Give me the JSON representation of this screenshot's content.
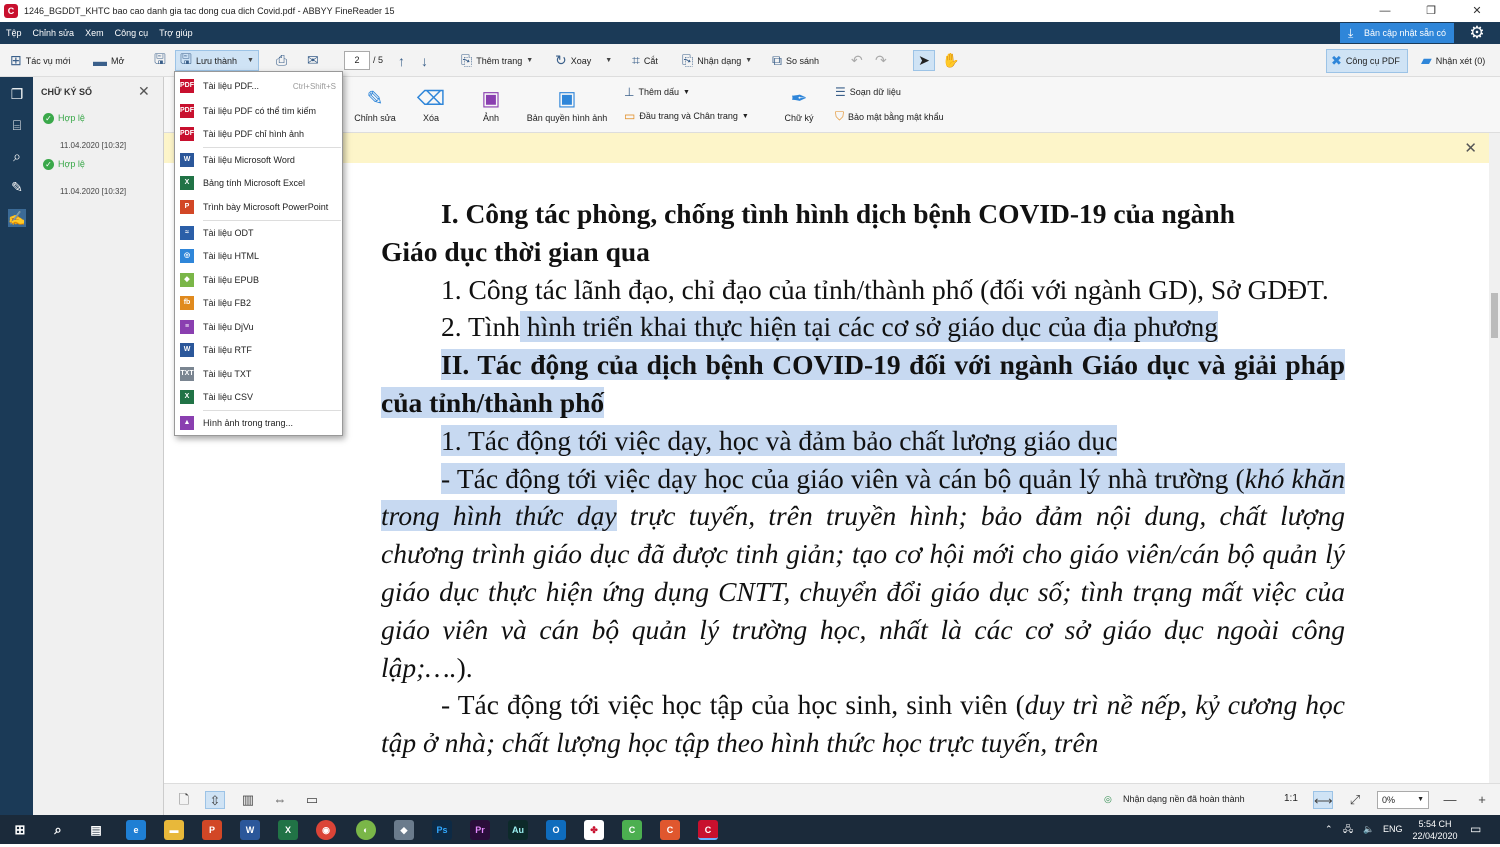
{
  "window": {
    "title": "1246_BGDDT_KHTC  bao cao danh gia tac dong cua dich Covid.pdf - ABBYY FineReader 15",
    "logo": "C"
  },
  "menubar": {
    "items": [
      "Tệp",
      "Chỉnh sửa",
      "Xem",
      "Công cụ",
      "Trợ giúp"
    ],
    "update_label": "Bản cập nhật sẵn có"
  },
  "toolbar": {
    "new_task": "Tác vụ mới",
    "open": "Mở",
    "save_as": "Lưu thành",
    "page_current": "2",
    "page_total": "/ 5",
    "add_page": "Thêm trang",
    "rotate": "Xoay",
    "crop": "Cắt",
    "recognize": "Nhận dạng",
    "compare": "So sánh",
    "pdf_tools": "Công cụ PDF",
    "comments": "Nhận xét (0)"
  },
  "save_menu": {
    "items": [
      {
        "label": "Tài liệu PDF...",
        "shortcut": "Ctrl+Shift+S",
        "icon": "PDF",
        "color": "#c8102e"
      },
      {
        "label": "Tài liệu PDF có thể tìm kiếm",
        "icon": "PDF",
        "color": "#c8102e"
      },
      {
        "label": "Tài liệu PDF chỉ hình ảnh",
        "icon": "PDF",
        "color": "#c8102e"
      },
      {
        "label": "Tài liệu Microsoft Word",
        "icon": "W",
        "color": "#2b579a"
      },
      {
        "label": "Bảng tính Microsoft Excel",
        "icon": "X",
        "color": "#217346"
      },
      {
        "label": "Trình bày Microsoft PowerPoint",
        "icon": "P",
        "color": "#d24726"
      },
      {
        "label": "Tài liệu ODT",
        "icon": "≈",
        "color": "#2b5fa8"
      },
      {
        "label": "Tài liệu HTML",
        "icon": "◎",
        "color": "#2f86d9"
      },
      {
        "label": "Tài liệu EPUB",
        "icon": "◆",
        "color": "#7ab648"
      },
      {
        "label": "Tài liệu FB2",
        "icon": "fb",
        "color": "#e08a1e"
      },
      {
        "label": "Tài liệu DjVu",
        "icon": "≡",
        "color": "#8a3fb0"
      },
      {
        "label": "Tài liệu RTF",
        "icon": "W",
        "color": "#2b579a"
      },
      {
        "label": "Tài liệu TXT",
        "icon": "TXT",
        "color": "#7a8591"
      },
      {
        "label": "Tài liệu CSV",
        "icon": "X",
        "color": "#217346"
      },
      {
        "label": "Hình ảnh trong trang...",
        "icon": "▲",
        "color": "#8a3fb0"
      }
    ]
  },
  "edit_toolbar": {
    "edit": "Chỉnh sửa",
    "erase": "Xóa",
    "image": "Ảnh",
    "image_rights": "Bản quyền hình ảnh",
    "add_stamp": "Thêm dấu",
    "header_footer": "Đầu trang và Chân trang",
    "signature": "Chữ ký",
    "edit_data": "Soạn dữ liệu",
    "password_protect": "Bảo mật bằng mật khẩu"
  },
  "signature_panel": {
    "header": "CHỮ KÝ SỐ",
    "entries": [
      {
        "status": "Hợp lệ",
        "date": "11.04.2020 [10:32]"
      },
      {
        "status": "Hợp lệ",
        "date": "11.04.2020 [10:32]"
      }
    ]
  },
  "document": {
    "h1_line1": "I. Công tác phòng, chống tình hình dịch bệnh COVID-19 của ngành",
    "h1_line2": "Giáo dục thời gian qua",
    "p1": "1. Công tác lãnh đạo, chỉ đạo của tỉnh/thành phố (đối với ngành GD), Sở GDĐT.",
    "p2_a": "2. Tình",
    "p2_b": " hình triển khai thực hiện tại các cơ sở giáo dục của địa phương",
    "h2": "II. Tác động của dịch bệnh COVID-19 đối với ngành Giáo dục và giải pháp của tỉnh/thành phố",
    "p3": "1. Tác động tới việc dạy, học và đảm bảo chất lượng giáo dục",
    "p4_a": "- Tác động tới việc dạy học của giáo viên và cán bộ quản lý nhà trường (",
    "p4_b": "khó khăn trong hình thức dạy",
    "p4_c": " trực tuyến, trên truyền hình; bảo đảm nội dung, chất lượng chương trình giáo dục đã được tinh giản; tạo cơ hội mới cho giáo viên/cán bộ quản lý giáo dục thực hiện ứng dụng CNTT, chuyển đổi giáo dục số; tình trạng mất việc của giáo viên và cán bộ quản lý trường học, nhất là các cơ sở giáo dục ngoài công lập;….",
    "p4_d": ").",
    "p5_a": "- Tác động tới việc học tập của học sinh, sinh viên (",
    "p5_b": "duy trì nề nếp, kỷ cương học tập ở nhà; chất lượng học tập theo hình thức học trực tuyến, trên"
  },
  "statusbar": {
    "recognition": "Nhận dạng nền đã hoàn thành",
    "ratio": "1:1",
    "zoom": "0%"
  },
  "taskbar": {
    "lang": "ENG",
    "time": "5:54 CH",
    "date": "22/04/2020"
  }
}
